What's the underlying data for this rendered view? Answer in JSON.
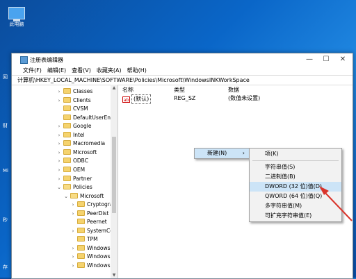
{
  "desktop": {
    "this_pc_label": "此电脑",
    "side_labels": [
      "回",
      "财",
      "Mi",
      "秒",
      "存"
    ]
  },
  "window": {
    "title": "注册表编辑器",
    "controls": {
      "minimize": "—",
      "maximize": "☐",
      "close": "✕"
    },
    "menu": [
      "文件(F)",
      "编辑(E)",
      "查看(V)",
      "收藏夹(A)",
      "帮助(H)"
    ],
    "address": "计算机\\HKEY_LOCAL_MACHINE\\SOFTWARE\\Policies\\Microsoft\\WindowsINKWorkSpace"
  },
  "tree": {
    "items": [
      {
        "label": "Classes",
        "chev": "›"
      },
      {
        "label": "Clients",
        "chev": "›"
      },
      {
        "label": "CVSM",
        "chev": ""
      },
      {
        "label": "DefaultUserEnvironr",
        "chev": ""
      },
      {
        "label": "Google",
        "chev": "›"
      },
      {
        "label": "Intel",
        "chev": "›"
      },
      {
        "label": "Macromedia",
        "chev": "›"
      },
      {
        "label": "Microsoft",
        "chev": "›"
      },
      {
        "label": "ODBC",
        "chev": "›"
      },
      {
        "label": "OEM",
        "chev": "›"
      },
      {
        "label": "Partner",
        "chev": "›"
      },
      {
        "label": "Policies",
        "chev": "⌄"
      },
      {
        "label": "Microsoft",
        "chev": "⌄"
      },
      {
        "label": "Cryptography",
        "chev": "›"
      },
      {
        "label": "PeerDist",
        "chev": "›"
      },
      {
        "label": "Peernet",
        "chev": ""
      },
      {
        "label": "SystemCertifica",
        "chev": "›"
      },
      {
        "label": "TPM",
        "chev": ""
      },
      {
        "label": "Windows",
        "chev": "›"
      },
      {
        "label": "Windows Adva",
        "chev": "›"
      },
      {
        "label": "Windows Defe",
        "chev": "›"
      }
    ],
    "scroll_up": "▲",
    "scroll_down": "▼"
  },
  "values": {
    "columns": [
      "名称",
      "类型",
      "数据"
    ],
    "rows": [
      {
        "icon": "ab",
        "name": "(默认)",
        "type": "REG_SZ",
        "data": "(数值未设置)"
      }
    ]
  },
  "context_menu": {
    "new_label": "新建(N)",
    "new_arrow": "›"
  },
  "submenu": {
    "items": [
      "项(K)",
      "字符串值(S)",
      "二进制值(B)",
      "DWORD (32 位)值(D)",
      "QWORD (64 位)值(Q)",
      "多字符串值(M)",
      "可扩充字符串值(E)"
    ],
    "highlighted_index": 3
  },
  "colors": {
    "annotation_arrow": "#d9342b"
  }
}
